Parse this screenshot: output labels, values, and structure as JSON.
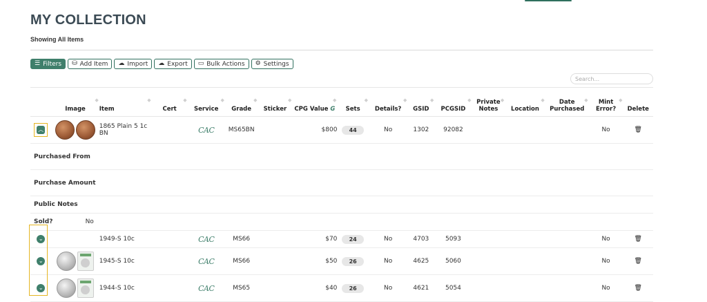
{
  "page": {
    "title": "MY COLLECTION",
    "subtitle": "Showing All Items"
  },
  "toolbar": {
    "filters": "Filters",
    "add_item": "Add Item",
    "import": "Import",
    "export": "Export",
    "bulk_actions": "Bulk Actions",
    "settings": "Settings",
    "icons": {
      "filters": "filter-icon",
      "add_item": "coins-icon",
      "import": "cloud-upload-icon",
      "export": "cloud-download-icon",
      "bulk_actions": "archive-icon",
      "settings": "gear-icon"
    }
  },
  "search": {
    "placeholder": "Search..."
  },
  "table": {
    "headers": {
      "image": "Image",
      "item": "Item",
      "cert": "Cert",
      "service": "Service",
      "grade": "Grade",
      "sticker": "Sticker",
      "cpg_value": "CPG Value",
      "sets": "Sets",
      "details": "Details?",
      "gsid": "GSID",
      "pcgsid": "PCGSID",
      "private_notes": "Private Notes",
      "location": "Location",
      "date_purchased": "Date Purchased",
      "mint_error": "Mint Error?",
      "delete": "Delete"
    },
    "rows": [
      {
        "item": "1865 Plain 5 1c BN",
        "cert": "",
        "service": "CAC",
        "grade": "MS65BN",
        "sticker": "",
        "cpg_value": "$800",
        "sets": "44",
        "details": "No",
        "gsid": "1302",
        "pcgsid": "92082",
        "private_notes": "",
        "location": "",
        "date_purchased": "",
        "mint_error": "No",
        "expanded": true
      },
      {
        "item": "1949-S 10c",
        "cert": "",
        "service": "CAC",
        "grade": "MS66",
        "sticker": "",
        "cpg_value": "$70",
        "sets": "24",
        "details": "No",
        "gsid": "4703",
        "pcgsid": "5093",
        "private_notes": "",
        "location": "",
        "date_purchased": "",
        "mint_error": "No",
        "expanded": false
      },
      {
        "item": "1945-S 10c",
        "cert": "",
        "service": "CAC",
        "grade": "MS66",
        "sticker": "",
        "cpg_value": "$50",
        "sets": "26",
        "details": "No",
        "gsid": "4625",
        "pcgsid": "5060",
        "private_notes": "",
        "location": "",
        "date_purchased": "",
        "mint_error": "No",
        "expanded": false
      },
      {
        "item": "1944-S 10c",
        "cert": "",
        "service": "CAC",
        "grade": "MS65",
        "sticker": "",
        "cpg_value": "$40",
        "sets": "26",
        "details": "No",
        "gsid": "4621",
        "pcgsid": "5054",
        "private_notes": "",
        "location": "",
        "date_purchased": "",
        "mint_error": "No",
        "expanded": false
      }
    ],
    "expanded_details": {
      "purchased_from": "Purchased From",
      "purchase_amount": "Purchase Amount",
      "public_notes": "Public Notes",
      "sold_label": "Sold?",
      "sold_value": "No"
    }
  },
  "colors": {
    "accent": "#3f7f6b",
    "highlight": "#e5b522"
  }
}
